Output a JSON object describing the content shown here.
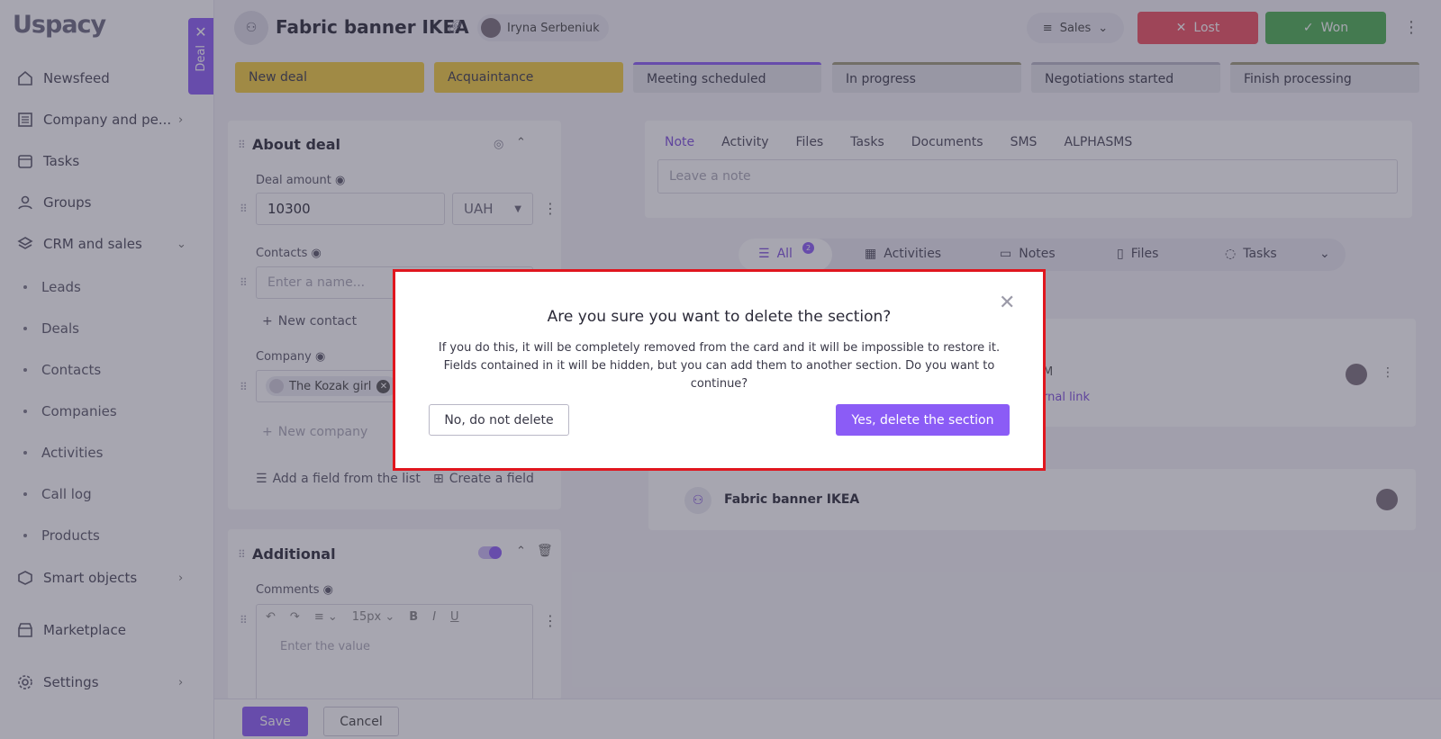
{
  "sidebar": {
    "logo": "Uspacy",
    "items": [
      {
        "label": "Newsfeed",
        "icon": "home-icon"
      },
      {
        "label": "Company and pe...",
        "icon": "building-icon"
      },
      {
        "label": "Tasks",
        "icon": "calendar-icon"
      },
      {
        "label": "Groups",
        "icon": "users-icon"
      },
      {
        "label": "CRM and sales",
        "icon": "layers-icon"
      },
      {
        "label": "Smart objects",
        "icon": "cube-icon"
      },
      {
        "label": "Marketplace",
        "icon": "store-icon"
      },
      {
        "label": "Settings",
        "icon": "gear-icon"
      }
    ],
    "crm_subitems": [
      "Leads",
      "Deals",
      "Contacts",
      "Companies",
      "Activities",
      "Call log",
      "Products"
    ]
  },
  "deal_tab": {
    "label": "Deal"
  },
  "header": {
    "title": "Fabric banner IKEA",
    "user": "Iryna Serbeniuk",
    "pipeline": "Sales",
    "lost_label": "Lost",
    "won_label": "Won"
  },
  "stages": [
    "New deal",
    "Acquaintance",
    "Meeting scheduled",
    "In progress",
    "Negotiations started",
    "Finish processing"
  ],
  "about": {
    "title": "About deal",
    "amount_label": "Deal amount",
    "amount_value": "10300",
    "currency": "UAH",
    "contacts_label": "Contacts",
    "contacts_placeholder": "Enter a name...",
    "new_contact": "New contact",
    "company_label": "Company",
    "company_value": "The Kozak girl",
    "new_company": "New company",
    "add_field": "Add a field from the list",
    "create_field": "Create a field"
  },
  "additional": {
    "title": "Additional",
    "comments_label": "Comments",
    "font_size": "15px",
    "comments_placeholder": "Enter the value"
  },
  "note_panel": {
    "tabs": [
      "Note",
      "Activity",
      "Files",
      "Tasks",
      "Documents",
      "SMS",
      "ALPHASMS"
    ],
    "note_placeholder": "Leave a note"
  },
  "filters": {
    "all": "All",
    "all_count": "2",
    "activities": "Activities",
    "notes": "Notes",
    "files": "Files",
    "tasks": "Tasks"
  },
  "feed": {
    "item1_time_fragment": "M",
    "item1_link_fragment": "rnal link",
    "item2_title": "Fabric banner IKEA"
  },
  "bottom": {
    "save": "Save",
    "cancel": "Cancel"
  },
  "modal": {
    "title": "Are you sure you want to delete the section?",
    "body_line1": "If you do this, it will be completely removed from the card and it will be impossible to restore it.",
    "body_line2": "Fields contained in it will be hidden, but you can add them to another section. Do you want to continue?",
    "no_label": "No, do not delete",
    "yes_label": "Yes, delete the section"
  }
}
